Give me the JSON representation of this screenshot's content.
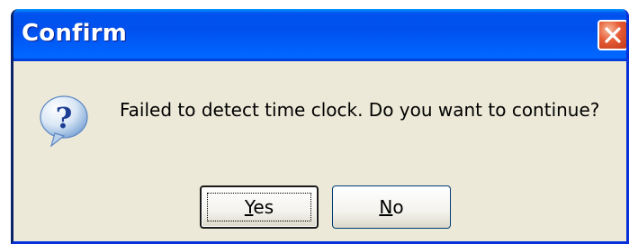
{
  "dialog": {
    "title": "Confirm",
    "message": "Failed to detect time clock. Do you want to continue?",
    "icon": "question-icon",
    "buttons": {
      "yes_label": "Yes",
      "no_label": "No"
    }
  },
  "colors": {
    "titlebar": "#0054e3",
    "window_bg": "#ece9d8",
    "close_button": "#e55b34"
  }
}
